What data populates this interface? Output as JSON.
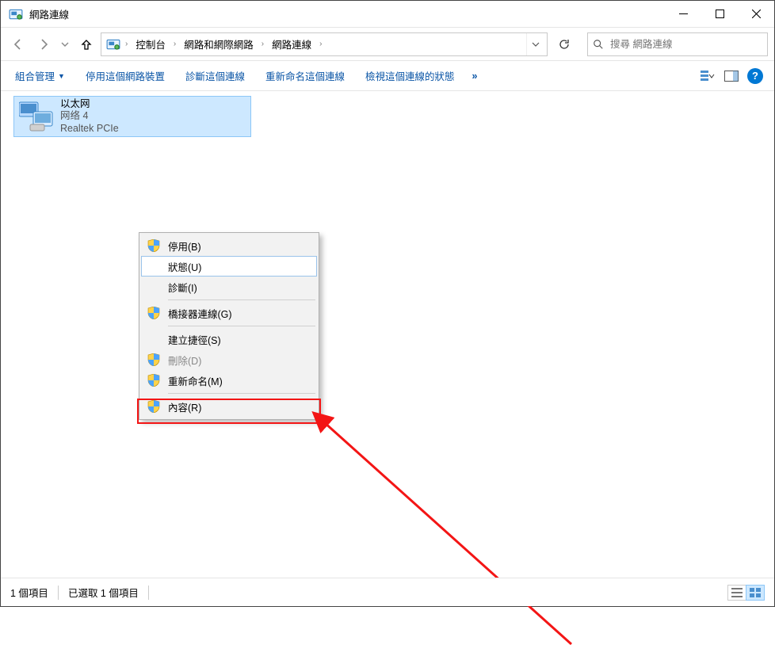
{
  "window": {
    "title": "網路連線"
  },
  "breadcrumbs": {
    "items": [
      "控制台",
      "網路和網際網路",
      "網路連線"
    ]
  },
  "search": {
    "placeholder": "搜尋 網路連線"
  },
  "commands": {
    "organize": "組合管理",
    "disable": "停用這個網路裝置",
    "diagnose": "診斷這個連線",
    "rename": "重新命名這個連線",
    "viewstatus": "檢視這個連線的狀態",
    "overflow": "»"
  },
  "connection": {
    "name": "以太网",
    "network": "网络 4",
    "device": "Realtek PCIe"
  },
  "context_menu": {
    "disable": "停用(B)",
    "status": "狀態(U)",
    "diagnose": "診斷(I)",
    "bridge": "橋接器連線(G)",
    "shortcut": "建立捷徑(S)",
    "delete": "刪除(D)",
    "rename": "重新命名(M)",
    "properties": "內容(R)"
  },
  "statusbar": {
    "count": "1 個項目",
    "selected": "已選取 1 個項目"
  }
}
